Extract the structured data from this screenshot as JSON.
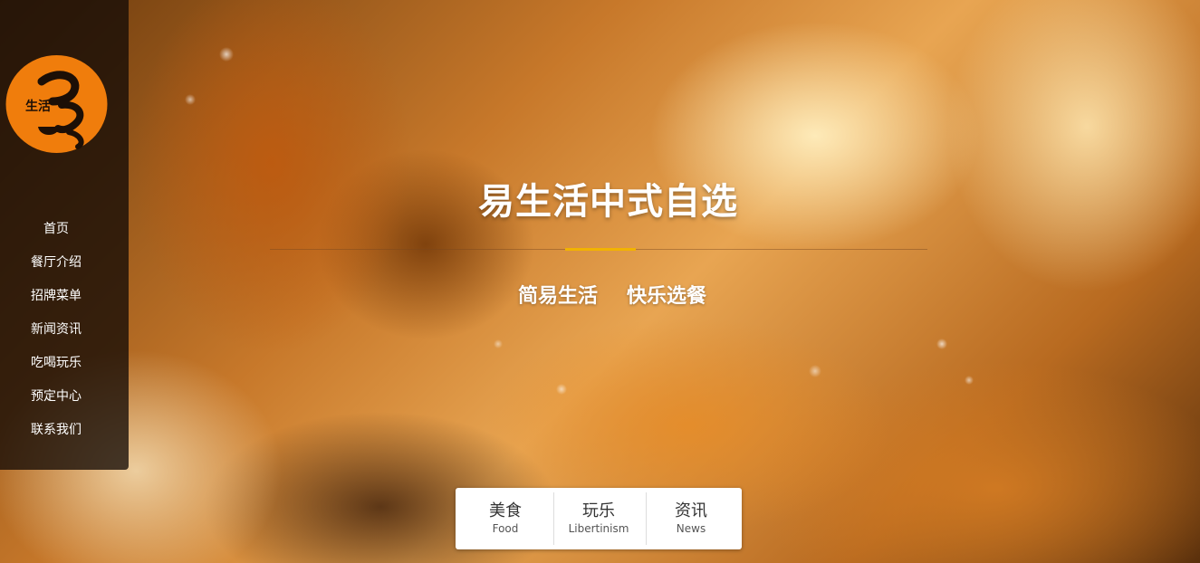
{
  "brand": {
    "logo_icon": "steaming-bowl-logo",
    "logo_text": "生活",
    "accent": "#f07d0c"
  },
  "nav": {
    "items": [
      {
        "label": "首页"
      },
      {
        "label": "餐厅介绍"
      },
      {
        "label": "招牌菜单"
      },
      {
        "label": "新闻资讯"
      },
      {
        "label": "吃喝玩乐"
      },
      {
        "label": "预定中心"
      },
      {
        "label": "联系我们"
      }
    ]
  },
  "hero": {
    "title": "易生活中式自选",
    "tagline_left": "简易生活",
    "tagline_right": "快乐选餐",
    "divider_accent_color": "#f2b300"
  },
  "tabs": [
    {
      "cn": "美食",
      "en": "Food"
    },
    {
      "cn": "玩乐",
      "en": "Libertinism"
    },
    {
      "cn": "资讯",
      "en": "News"
    }
  ]
}
